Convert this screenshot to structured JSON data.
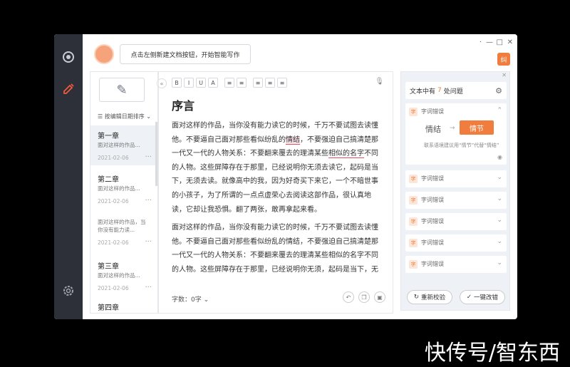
{
  "topbar": {
    "hint": "点击左侧新建文档按钮，开始智能写作",
    "badge": "纠"
  },
  "sidebar": {
    "sort_label": "按编辑日期排序",
    "docs": [
      {
        "title": "第一章",
        "snippet": "面对这样的作品...",
        "date": "2021-02-06"
      },
      {
        "title": "第二章",
        "snippet": "面对这样的作品...",
        "date": "2021-02-06"
      },
      {
        "title": "",
        "snippet": "面对这样的作品，当你没有能力读...",
        "date": "2021-02-06"
      },
      {
        "title": "第三章",
        "snippet": "面对这样的作品...",
        "date": "2021-02-06"
      },
      {
        "title": "第四章",
        "snippet": "",
        "date": ""
      }
    ]
  },
  "editor": {
    "toolbar": [
      "B",
      "I",
      "U",
      "A",
      "≡",
      "≡",
      "≡",
      "≡",
      "≡"
    ],
    "title": "序言",
    "p1_a": "面对这样的作品，当你没有能力读它的时候，千万不要试图去读懂他。不要逼自己面对那些看似纷乱的",
    "p1_hl": "情结",
    "p1_b": "，不要强迫自己搞清楚那一代又一代的人物关系：不要翻来覆去的理清某些",
    "p1_ul": "相似的名字",
    "p1_c": "不同的人物。这些屏障存在于那里，已经说明你无须去读它，起码是当下，无须去读。就像高中的我，因为好奇买下来它，一个不暗世事的小孩子，为了所谓的一点点虚荣心去阅读这部作品，很认真地读，它却让我恐惧。翻了两张，敢再拿起来看。",
    "p2": "面对这样的作品，当你没有能力读它的时候，千万不要试图去读懂他。不要逼自己面对那些看似纷乱的情结，不要强迫自己搞清楚那一代又一代的人物关系：不要翻来覆去的理清某些相似的名字不同的人物。这些屏障存在于那里，已经说明你无须，起码是当下，无须去读。就像高中的我，因为好奇买下来它，一个不暗世事的小孩子。",
    "word_count": "字数：0字"
  },
  "panel": {
    "head_prefix": "文本中有",
    "issue_count": "7",
    "head_suffix": "处问题",
    "issue_label": "字词错误",
    "open_issue": {
      "original": "情结",
      "suggestion": "情节",
      "desc": "联系语境建议用“情节”代替“情结”"
    },
    "recheck_label": "重新校验",
    "fix_all_label": "一键改错"
  },
  "watermark": "快传号/智东西"
}
